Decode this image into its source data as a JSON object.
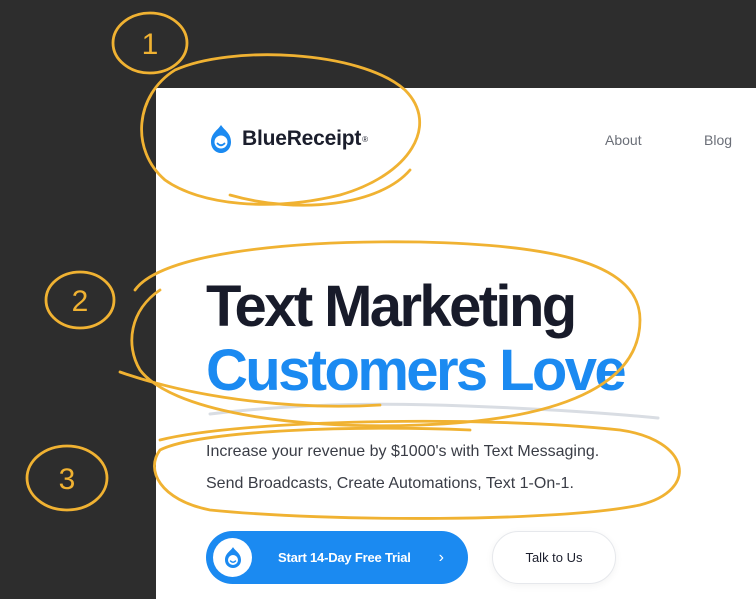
{
  "header": {
    "brand_name": "BlueReceipt",
    "brand_mark": "®",
    "nav": [
      {
        "label": "About"
      },
      {
        "label": "Blog"
      }
    ]
  },
  "hero": {
    "line1": "Text Marketing",
    "line2": "Customers Love",
    "sub1": "Increase your revenue by $1000's with Text Messaging.",
    "sub2": "Send Broadcasts, Create Automations, Text 1-On-1."
  },
  "cta": {
    "primary_label": "Start 14-Day Free Trial",
    "primary_arrow": "›",
    "secondary_label": "Talk to Us"
  },
  "annotations": {
    "n1": "1",
    "n2": "2",
    "n3": "3"
  },
  "colors": {
    "brand_blue": "#1b8af1",
    "headline_dark": "#181b2a",
    "annotation_ink": "#f0b232",
    "backdrop": "#2d2d2d"
  }
}
